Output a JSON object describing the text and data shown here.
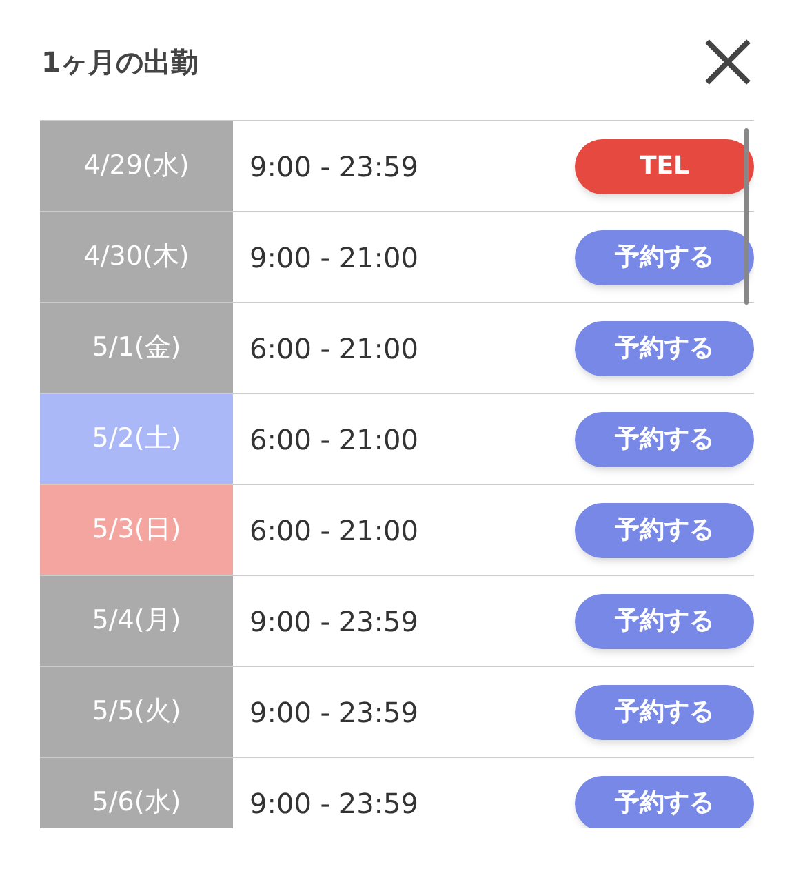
{
  "title": "1ヶ月の出勤",
  "rows": [
    {
      "date": "4/29(水)",
      "color": "#ababab",
      "hours": "9:00 - 23:59",
      "button": {
        "kind": "tel",
        "label": "TEL"
      }
    },
    {
      "date": "4/30(木)",
      "color": "#ababab",
      "hours": "9:00 - 21:00",
      "button": {
        "kind": "reserve",
        "label": "予約する"
      }
    },
    {
      "date": "5/1(金)",
      "color": "#ababab",
      "hours": "6:00 - 21:00",
      "button": {
        "kind": "reserve",
        "label": "予約する"
      }
    },
    {
      "date": "5/2(土)",
      "color": "#aab8f7",
      "hours": "6:00 - 21:00",
      "button": {
        "kind": "reserve",
        "label": "予約する"
      }
    },
    {
      "date": "5/3(日)",
      "color": "#f5a59f",
      "hours": "6:00 - 21:00",
      "button": {
        "kind": "reserve",
        "label": "予約する"
      }
    },
    {
      "date": "5/4(月)",
      "color": "#ababab",
      "hours": "9:00 - 23:59",
      "button": {
        "kind": "reserve",
        "label": "予約する"
      }
    },
    {
      "date": "5/5(火)",
      "color": "#ababab",
      "hours": "9:00 - 23:59",
      "button": {
        "kind": "reserve",
        "label": "予約する"
      }
    },
    {
      "date": "5/6(水)",
      "color": "#ababab",
      "hours": "9:00 - 23:59",
      "button": {
        "kind": "reserve",
        "label": "予約する"
      }
    }
  ]
}
